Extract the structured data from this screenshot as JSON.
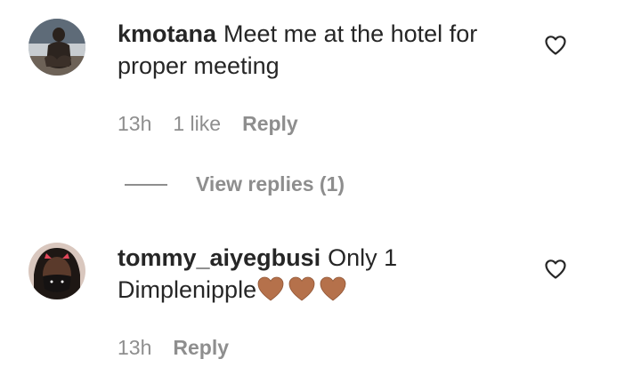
{
  "comments": [
    {
      "username": "kmotana",
      "text": "Meet me at the hotel for proper meeting",
      "time": "13h",
      "likes": "1 like",
      "reply_label": "Reply",
      "view_replies": "View replies (1)"
    },
    {
      "username": "tommy_aiyegbusi",
      "text": "Only 1 Dimplenipple",
      "emoji": [
        "brown-heart",
        "brown-heart",
        "brown-heart"
      ],
      "time": "13h",
      "reply_label": "Reply"
    }
  ],
  "colors": {
    "text": "#262626",
    "secondary": "#8e8e8e",
    "brown_heart": "#b5714b"
  },
  "icons": {
    "like": "heart-outline-icon"
  }
}
